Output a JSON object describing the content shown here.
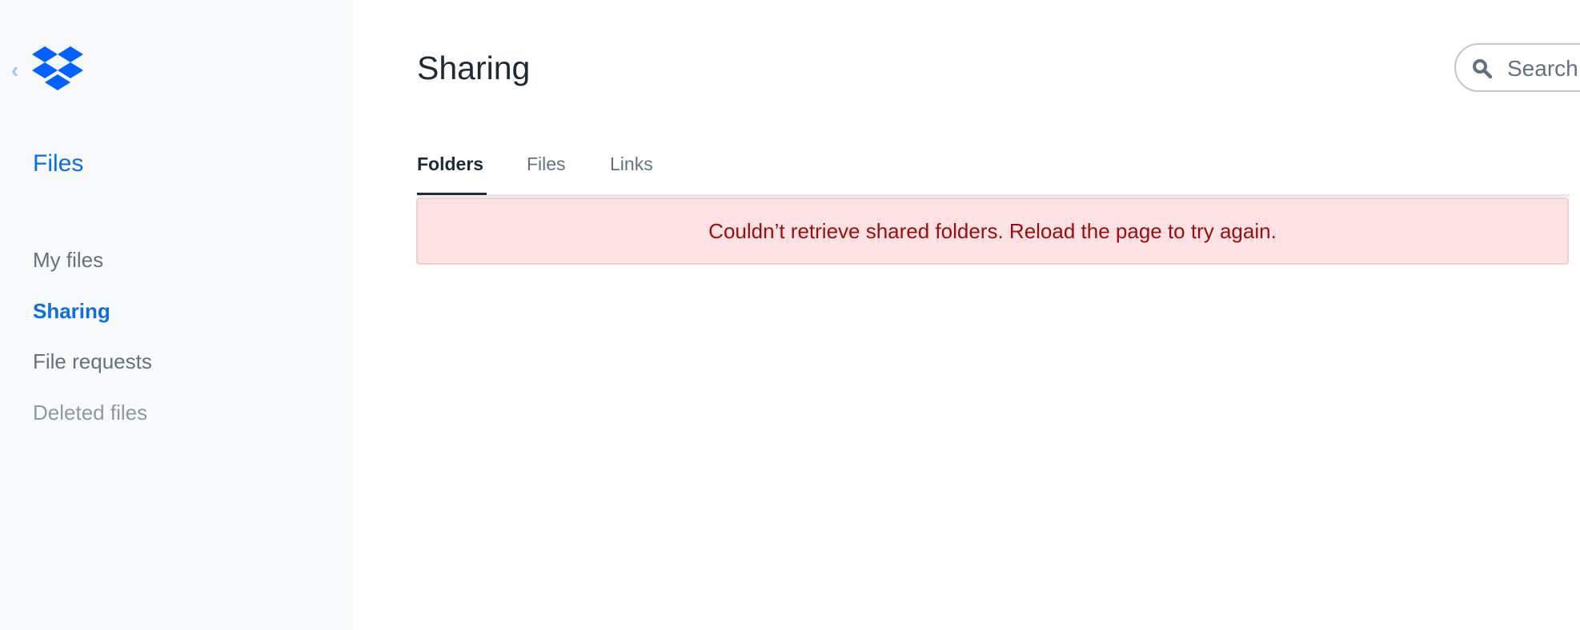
{
  "sidebar": {
    "section_title": "Files",
    "items": [
      {
        "label": "My files",
        "state": "normal"
      },
      {
        "label": "Sharing",
        "state": "active"
      },
      {
        "label": "File requests",
        "state": "normal"
      },
      {
        "label": "Deleted files",
        "state": "muted"
      }
    ]
  },
  "header": {
    "title": "Sharing"
  },
  "search": {
    "placeholder": "Search"
  },
  "tabs": [
    {
      "label": "Folders",
      "active": true
    },
    {
      "label": "Files",
      "active": false
    },
    {
      "label": "Links",
      "active": false
    }
  ],
  "error": {
    "message": "Couldn’t retrieve shared folders. Reload the page to try again."
  },
  "colors": {
    "accent": "#0d6ee0",
    "error_bg": "#fee2e3",
    "error_text": "#9b0c0c"
  }
}
